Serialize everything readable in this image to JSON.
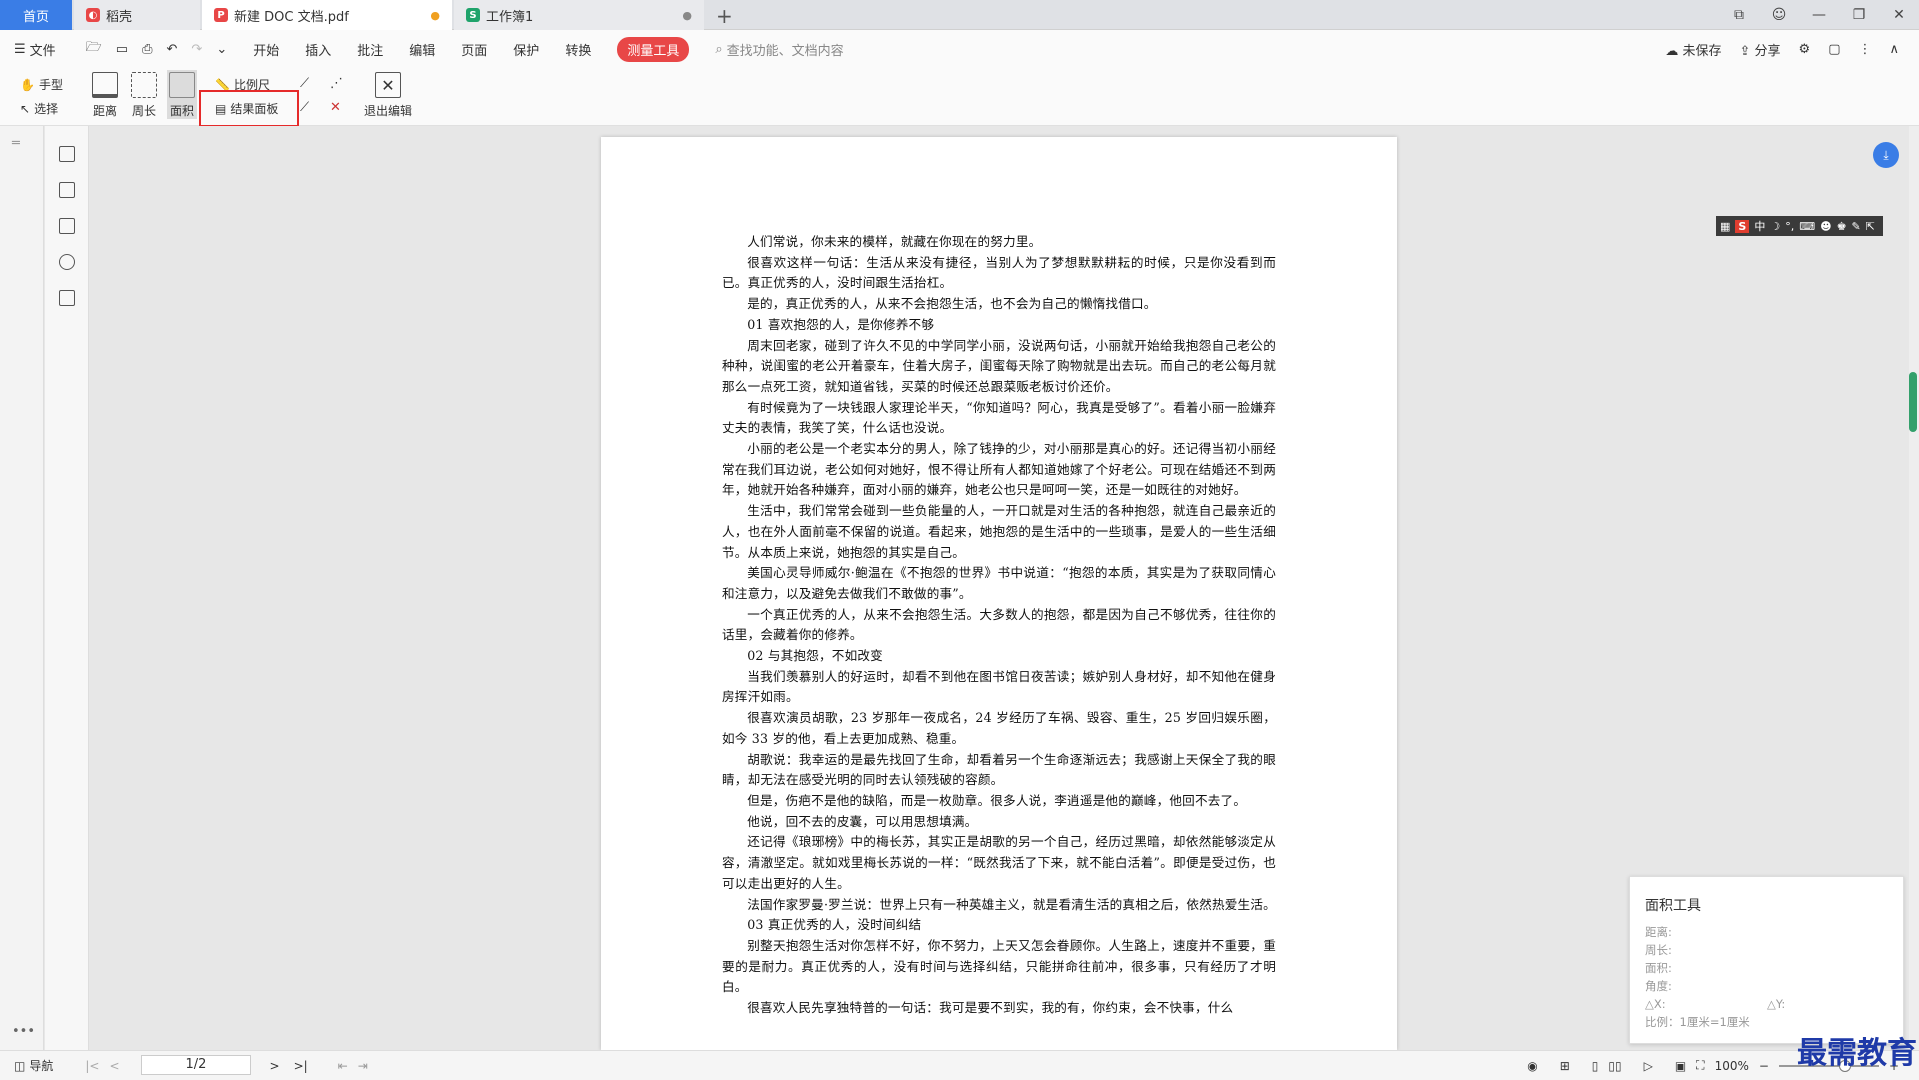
{
  "tabs": {
    "home": "首页",
    "shell": "稻壳",
    "pdf": "新建 DOC 文档.pdf",
    "sheet": "工作簿1",
    "add": "+"
  },
  "menu": {
    "file": "文件",
    "items": [
      "开始",
      "插入",
      "批注",
      "编辑",
      "页面",
      "保护",
      "转换"
    ],
    "measure": "测量工具",
    "search_placeholder": "查找功能、文档内容",
    "unsaved": "未保存",
    "share": "分享"
  },
  "ribbon": {
    "hand": "手型",
    "select": "选择",
    "distance": "距离",
    "perimeter": "周长",
    "area": "面积",
    "ruler": "比例尺",
    "result_panel": "结果面板",
    "exit_edit": "退出编辑"
  },
  "document": {
    "paragraphs": [
      "人们常说，你未来的模样，就藏在你现在的努力里。",
      "很喜欢这样一句话：生活从来没有捷径，当别人为了梦想默默耕耘的时候，只是你没看到而已。真正优秀的人，没时间跟生活抬杠。",
      "是的，真正优秀的人，从来不会抱怨生活，也不会为自己的懒惰找借口。",
      "01 喜欢抱怨的人，是你修养不够",
      "周末回老家，碰到了许久不见的中学同学小丽，没说两句话，小丽就开始给我抱怨自己老公的种种，说闺蜜的老公开着豪车，住着大房子，闺蜜每天除了购物就是出去玩。而自己的老公每月就那么一点死工资，就知道省钱，买菜的时候还总跟菜贩老板讨价还价。",
      "有时候竟为了一块钱跟人家理论半天，“你知道吗？阿心，我真是受够了”。看着小丽一脸嫌弃丈夫的表情，我笑了笑，什么话也没说。",
      "小丽的老公是一个老实本分的男人，除了钱挣的少，对小丽那是真心的好。还记得当初小丽经常在我们耳边说，老公如何对她好，恨不得让所有人都知道她嫁了个好老公。可现在结婚还不到两年，她就开始各种嫌弃，面对小丽的嫌弃，她老公也只是呵呵一笑，还是一如既往的对她好。",
      "生活中，我们常常会碰到一些负能量的人，一开口就是对生活的各种抱怨，就连自己最亲近的人，也在外人面前毫不保留的说道。看起来，她抱怨的是生活中的一些琐事，是爱人的一些生活细节。从本质上来说，她抱怨的其实是自己。",
      "美国心灵导师威尔·鲍温在《不抱怨的世界》书中说道：“抱怨的本质，其实是为了获取同情心和注意力，以及避免去做我们不敢做的事”。",
      "一个真正优秀的人，从来不会抱怨生活。大多数人的抱怨，都是因为自己不够优秀，往往你的话里，会藏着你的修养。",
      "02 与其抱怨，不如改变",
      "当我们羡慕别人的好运时，却看不到他在图书馆日夜苦读；嫉妒别人身材好，却不知他在健身房挥汗如雨。",
      "很喜欢演员胡歌，23 岁那年一夜成名，24 岁经历了车祸、毁容、重生，25 岁回归娱乐圈，如今 33 岁的他，看上去更加成熟、稳重。",
      "胡歌说：我幸运的是最先找回了生命，却看着另一个生命逐渐远去；我感谢上天保全了我的眼睛，却无法在感受光明的同时去认领残破的容颜。",
      "但是，伤疤不是他的缺陷，而是一枚勋章。很多人说，李逍遥是他的巅峰，他回不去了。",
      "他说，回不去的皮囊，可以用思想填满。",
      "还记得《琅琊榜》中的梅长苏，其实正是胡歌的另一个自己，经历过黑暗，却依然能够淡定从容，清澈坚定。就如戏里梅长苏说的一样：“既然我活了下来，就不能白活着”。即便是受过伤，也可以走出更好的人生。",
      "法国作家罗曼·罗兰说：世界上只有一种英雄主义，就是看清生活的真相之后，依然热爱生活。",
      "03 真正优秀的人，没时间纠结",
      "别整天抱怨生活对你怎样不好，你不努力，上天又怎会眷顾你。人生路上，速度并不重要，重要的是耐力。真正优秀的人，没有时间与选择纠结，只能拼命往前冲，很多事，只有经历了才明白。",
      "很喜欢人民先享独特普的一句话：我可是要不到实，我的有，你约束，会不快事，什么"
    ]
  },
  "result_panel": {
    "title": "面积工具",
    "distance": "距离:",
    "perimeter": "周长:",
    "area": "面积:",
    "angle": "角度:",
    "dx": "△X:",
    "dy": "△Y:",
    "scale": "比例：1厘米=1厘米"
  },
  "status": {
    "nav": "导航",
    "page": "1/2",
    "zoom": "100%"
  },
  "watermark": "最需教育",
  "colors": {
    "accent": "#3a7de6",
    "measure": "#e84747",
    "highlight": "#e52a2a"
  }
}
